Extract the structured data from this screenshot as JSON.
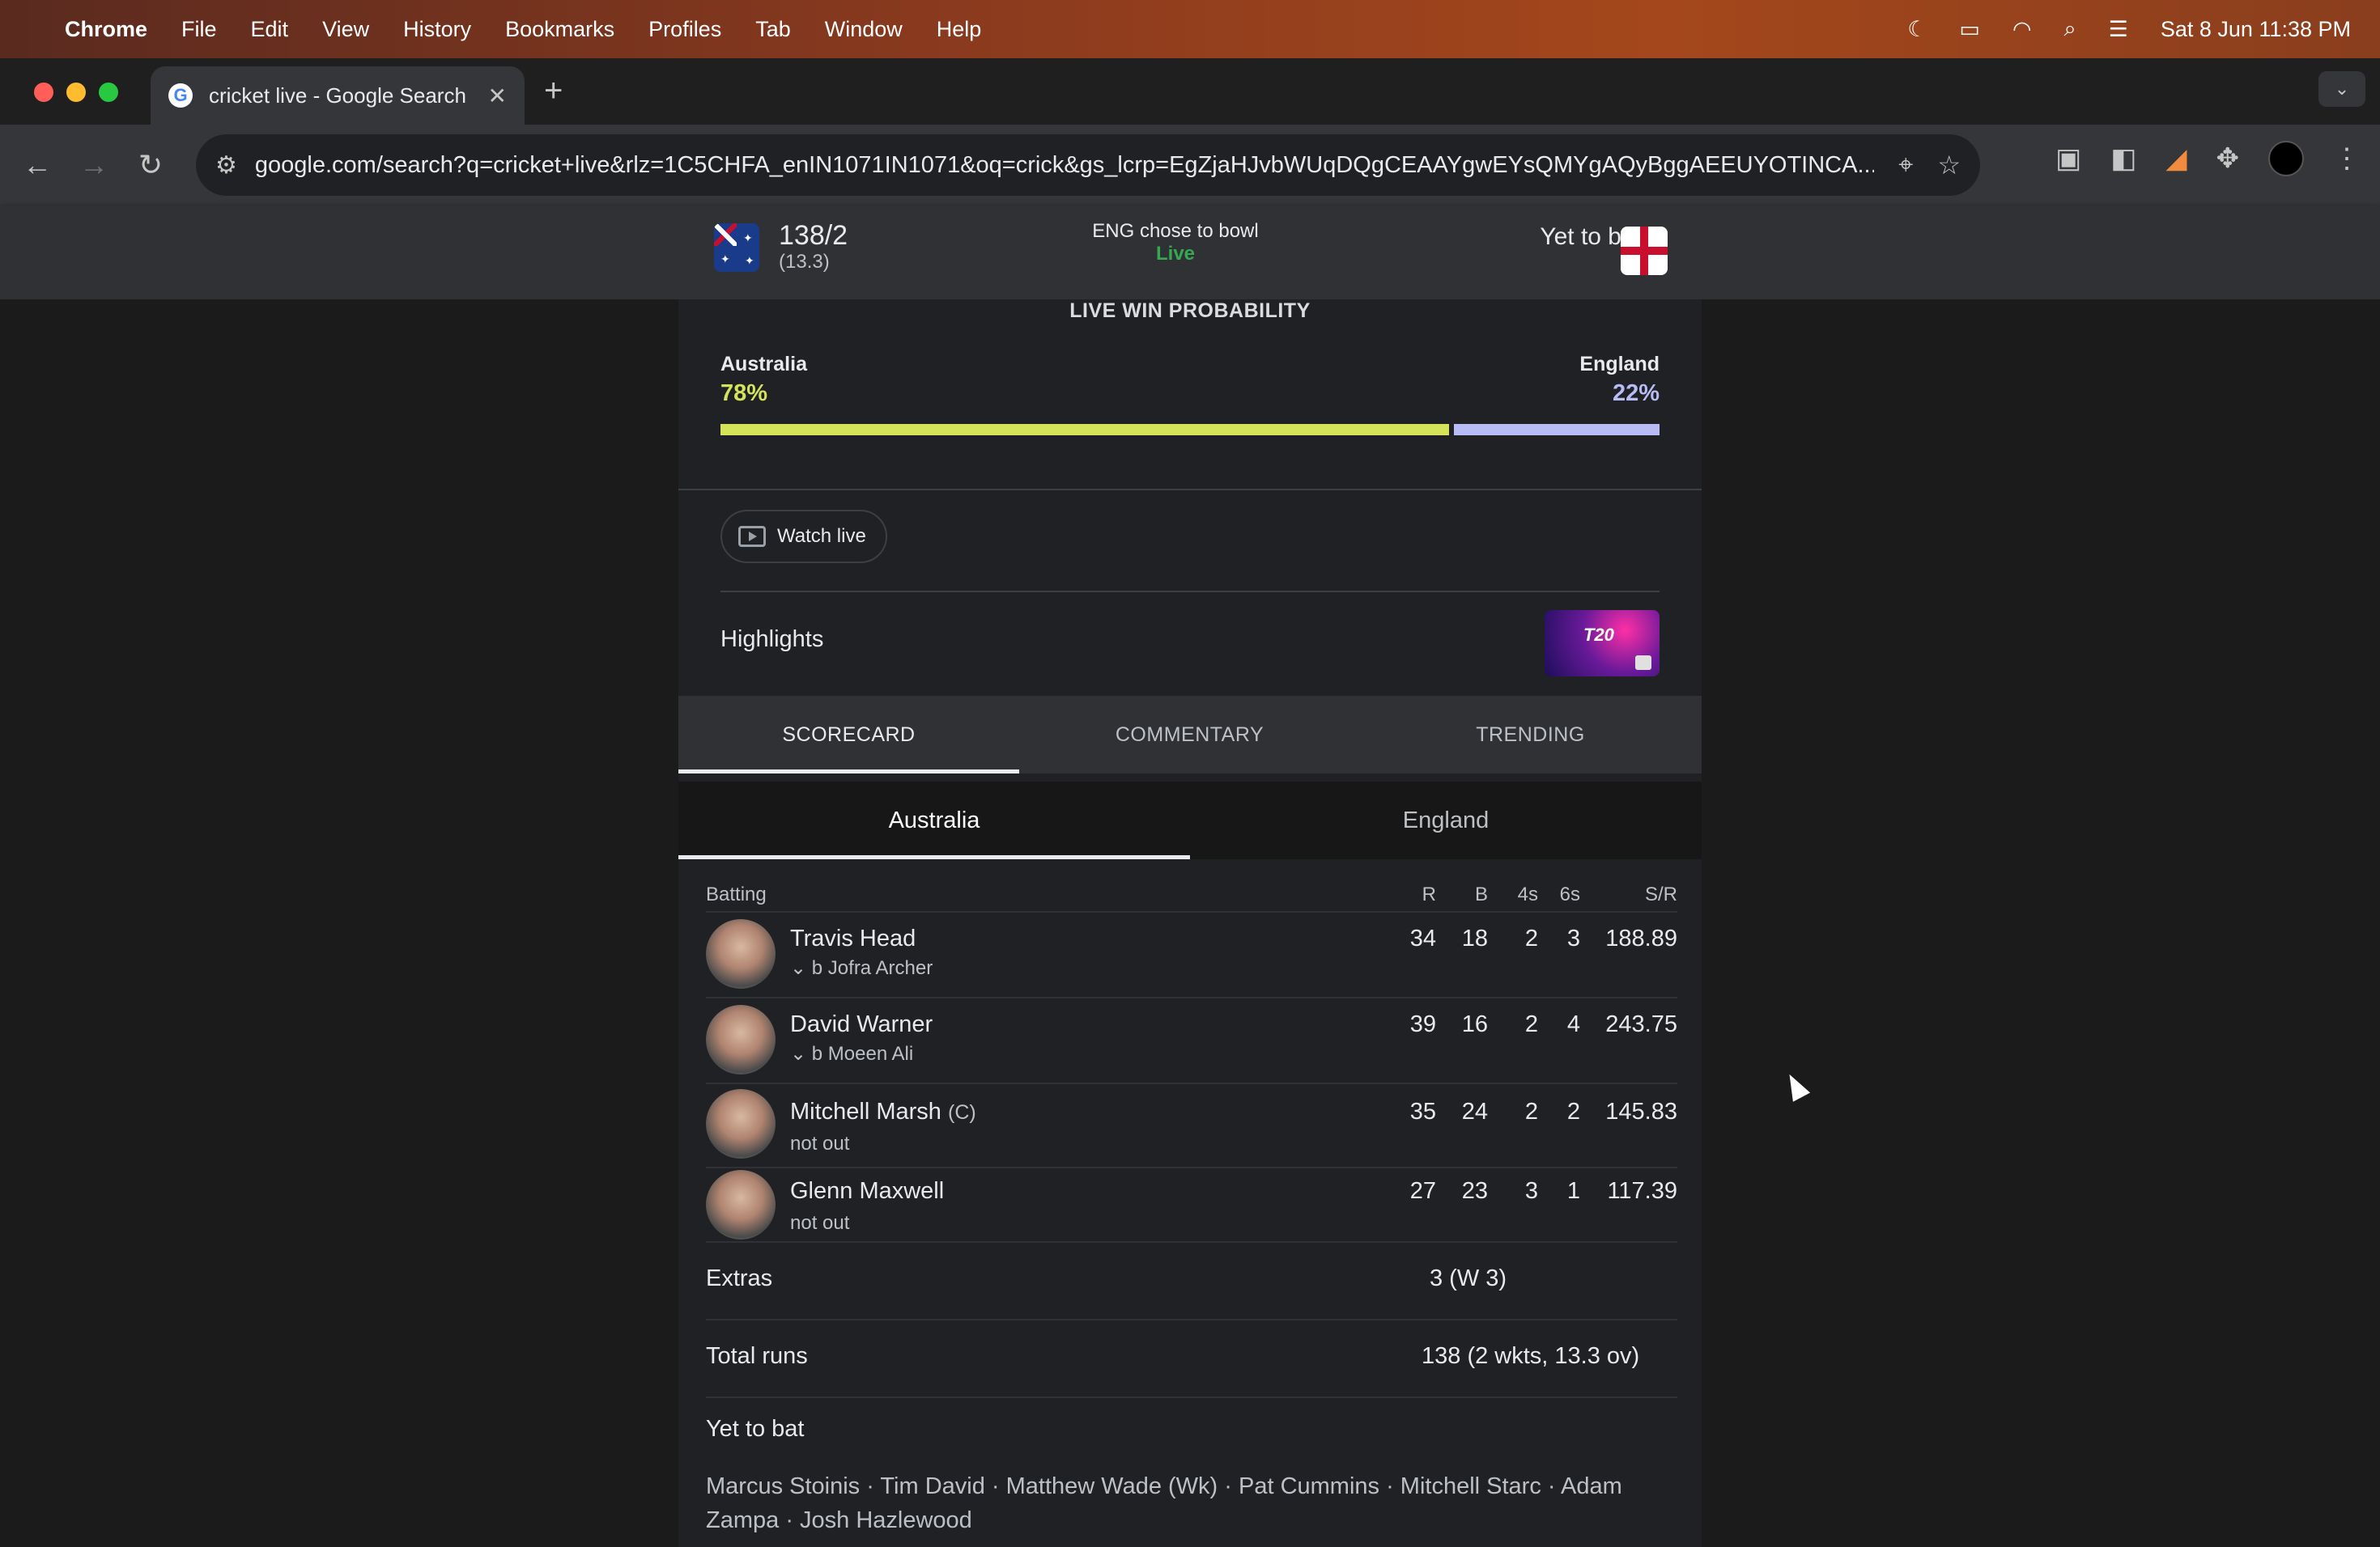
{
  "menubar": {
    "app": "Chrome",
    "items": [
      "File",
      "Edit",
      "View",
      "History",
      "Bookmarks",
      "Profiles",
      "Tab",
      "Window",
      "Help"
    ],
    "clock": "Sat 8 Jun  11:38 PM"
  },
  "browser": {
    "tab_title": "cricket live - Google Search",
    "url": "google.com/search?q=cricket+live&rlz=1C5CHFA_enIN1071IN1071&oq=crick&gs_lcrp=EgZjaHJvbWUqDQgCEAAYgwEYsQMYgAQyBggAEEUYOTINCA..."
  },
  "match": {
    "aus_score": "138/2",
    "aus_overs": "(13.3)",
    "toss": "ENG chose to bowl",
    "status": "Live",
    "eng_status": "Yet to bat"
  },
  "win_probability": {
    "title": "LIVE WIN PROBABILITY",
    "team_left": "Australia",
    "pct_left": "78%",
    "team_right": "England",
    "pct_right": "22%",
    "left_fraction": 0.78,
    "colors": {
      "left": "#d4e35a",
      "right": "#b8bcf5"
    }
  },
  "watch_live": "Watch live",
  "highlights": {
    "label": "Highlights",
    "thumb_text": "T20"
  },
  "tabs": [
    "SCORECARD",
    "COMMENTARY",
    "TRENDING"
  ],
  "team_tabs": [
    "Australia",
    "England"
  ],
  "batting": {
    "header": {
      "label": "Batting",
      "r": "R",
      "b": "B",
      "fours": "4s",
      "sixes": "6s",
      "sr": "S/R"
    },
    "players": [
      {
        "name": "Travis Head",
        "cap": "",
        "dismissal": "b Jofra Archer",
        "r": "34",
        "b": "18",
        "fours": "2",
        "sixes": "3",
        "sr": "188.89"
      },
      {
        "name": "David Warner",
        "cap": "",
        "dismissal": "b Moeen Ali",
        "r": "39",
        "b": "16",
        "fours": "2",
        "sixes": "4",
        "sr": "243.75"
      },
      {
        "name": "Mitchell Marsh",
        "cap": "(C)",
        "dismissal": "not out",
        "r": "35",
        "b": "24",
        "fours": "2",
        "sixes": "2",
        "sr": "145.83"
      },
      {
        "name": "Glenn Maxwell",
        "cap": "",
        "dismissal": "not out",
        "r": "27",
        "b": "23",
        "fours": "3",
        "sixes": "1",
        "sr": "117.39"
      }
    ]
  },
  "extras": {
    "label": "Extras",
    "value": "3  (W 3)"
  },
  "total": {
    "label": "Total runs",
    "value": "138 (2 wkts, 13.3 ov)"
  },
  "yet_to_bat": {
    "label": "Yet to bat",
    "players": "Marcus Stoinis · Tim David · Matthew Wade (Wk) · Pat Cummins · Mitchell Starc · Adam Zampa · Josh Hazlewood"
  }
}
